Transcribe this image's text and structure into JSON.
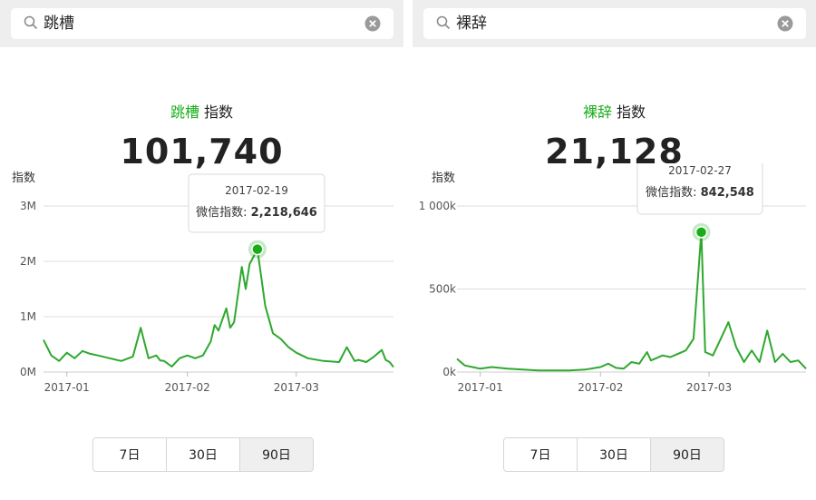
{
  "panels": [
    {
      "search_text": "跳槽",
      "title_keyword": "跳槽",
      "title_suffix": "指数",
      "index_value": "101,740",
      "y_axis_label": "指数",
      "tooltip_date": "2017-02-19",
      "tooltip_label": "微信指数:",
      "tooltip_value": "2,218,646",
      "range_buttons": [
        "7日",
        "30日",
        "90日"
      ],
      "active_range": "90日"
    },
    {
      "search_text": "裸辞",
      "title_keyword": "裸辞",
      "title_suffix": "指数",
      "index_value": "21,128",
      "y_axis_label": "指数",
      "tooltip_date": "2017-02-27",
      "tooltip_label": "微信指数:",
      "tooltip_value": "842,548",
      "range_buttons": [
        "7日",
        "30日",
        "90日"
      ],
      "active_range": "90日"
    }
  ],
  "colors": {
    "accent": "#1aad19",
    "line": "#2ea82e",
    "grid": "#dddddd",
    "search_bg": "#eeeeee"
  },
  "chart_data": [
    {
      "type": "line",
      "title": "跳槽 指数",
      "ylabel": "指数",
      "ylim": [
        0,
        3000000
      ],
      "y_ticks": [
        "0M",
        "1M",
        "2M",
        "3M"
      ],
      "x_ticks": [
        "2017-01",
        "2017-02",
        "2017-03"
      ],
      "x": [
        "2016-12-26",
        "2016-12-28",
        "2016-12-30",
        "2017-01-01",
        "2017-01-03",
        "2017-01-05",
        "2017-01-07",
        "2017-01-09",
        "2017-01-12",
        "2017-01-15",
        "2017-01-18",
        "2017-01-20",
        "2017-01-22",
        "2017-01-24",
        "2017-01-25",
        "2017-01-26",
        "2017-01-28",
        "2017-01-30",
        "2017-02-01",
        "2017-02-03",
        "2017-02-05",
        "2017-02-07",
        "2017-02-08",
        "2017-02-09",
        "2017-02-11",
        "2017-02-12",
        "2017-02-13",
        "2017-02-15",
        "2017-02-16",
        "2017-02-17",
        "2017-02-19",
        "2017-02-21",
        "2017-02-23",
        "2017-02-25",
        "2017-02-27",
        "2017-03-01",
        "2017-03-04",
        "2017-03-08",
        "2017-03-12",
        "2017-03-14",
        "2017-03-16",
        "2017-03-17",
        "2017-03-19",
        "2017-03-21",
        "2017-03-23",
        "2017-03-24",
        "2017-03-25",
        "2017-03-26"
      ],
      "series": [
        {
          "values": [
            580000,
            300000,
            200000,
            350000,
            250000,
            380000,
            330000,
            300000,
            250000,
            200000,
            280000,
            800000,
            250000,
            300000,
            210000,
            200000,
            100000,
            250000,
            300000,
            250000,
            300000,
            550000,
            850000,
            750000,
            1150000,
            800000,
            900000,
            1900000,
            1500000,
            1950000,
            2218646,
            1200000,
            700000,
            600000,
            450000,
            350000,
            250000,
            200000,
            180000,
            450000,
            200000,
            220000,
            180000,
            280000,
            400000,
            220000,
            180000,
            90000
          ]
        }
      ]
    },
    {
      "type": "line",
      "title": "裸辞 指数",
      "ylabel": "指数",
      "ylim": [
        0,
        1000000
      ],
      "y_ticks": [
        "0k",
        "500k",
        "1 000k"
      ],
      "x_ticks": [
        "2017-01",
        "2017-02",
        "2017-03"
      ],
      "x": [
        "2016-12-26",
        "2016-12-28",
        "2016-12-30",
        "2017-01-01",
        "2017-01-04",
        "2017-01-08",
        "2017-01-12",
        "2017-01-16",
        "2017-01-20",
        "2017-01-24",
        "2017-01-28",
        "2017-02-01",
        "2017-02-03",
        "2017-02-05",
        "2017-02-07",
        "2017-02-09",
        "2017-02-11",
        "2017-02-13",
        "2017-02-14",
        "2017-02-15",
        "2017-02-17",
        "2017-02-19",
        "2017-02-21",
        "2017-02-23",
        "2017-02-25",
        "2017-02-27",
        "2017-02-28",
        "2017-03-02",
        "2017-03-04",
        "2017-03-06",
        "2017-03-08",
        "2017-03-10",
        "2017-03-12",
        "2017-03-14",
        "2017-03-16",
        "2017-03-18",
        "2017-03-20",
        "2017-03-22",
        "2017-03-24",
        "2017-03-26"
      ],
      "series": [
        {
          "values": [
            80000,
            40000,
            30000,
            20000,
            30000,
            20000,
            15000,
            10000,
            10000,
            10000,
            15000,
            30000,
            50000,
            25000,
            20000,
            60000,
            50000,
            120000,
            70000,
            80000,
            100000,
            90000,
            110000,
            130000,
            200000,
            842548,
            120000,
            100000,
            200000,
            300000,
            150000,
            60000,
            130000,
            60000,
            250000,
            60000,
            110000,
            60000,
            70000,
            20000
          ]
        }
      ]
    }
  ]
}
